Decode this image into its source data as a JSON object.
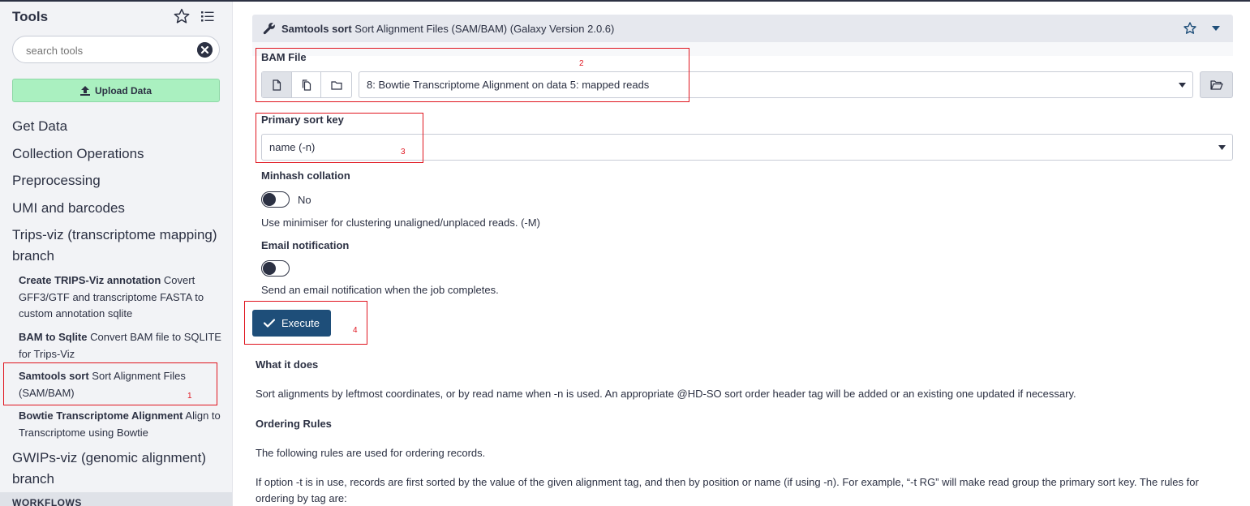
{
  "tools_panel": {
    "title": "Tools",
    "search": {
      "placeholder": "search tools",
      "value": ""
    },
    "upload_label": "Upload Data",
    "sections": [
      "Get Data",
      "Collection Operations",
      "Preprocessing",
      "UMI and barcodes",
      "Trips-viz (transcriptome mapping) branch",
      "GWIPs-viz (genomic alignment) branch"
    ],
    "tools": [
      {
        "name": "Create TRIPS-Viz annotation",
        "desc": " Covert GFF3/GTF and transcriptome FASTA to custom annotation sqlite"
      },
      {
        "name": "BAM to Sqlite",
        "desc": " Convert BAM file to SQLITE for Trips-Viz"
      },
      {
        "name": "Samtools sort",
        "desc": " Sort Alignment Files (SAM/BAM)"
      },
      {
        "name": "Bowtie Transcriptome Alignment",
        "desc": " Align to Transcriptome using Bowtie"
      }
    ],
    "workflows_label": "WORKFLOWS"
  },
  "tool_form": {
    "name": "Samtools sort",
    "description": " Sort Alignment Files (SAM/BAM) (Galaxy Version 2.0.6)",
    "bam_file": {
      "label": "BAM File",
      "value": "8: Bowtie Transcriptome Alignment on data 5: mapped reads"
    },
    "primary_sort_key": {
      "label": "Primary sort key",
      "value": "name (-n)"
    },
    "minhash": {
      "label": "Minhash collation",
      "toggle_text": "No",
      "help": "Use minimiser for clustering unaligned/unplaced reads. (-M)"
    },
    "email": {
      "label": "Email notification",
      "help": "Send an email notification when the job completes."
    },
    "execute_label": "Execute"
  },
  "help_section": {
    "what_it_does_title": "What it does",
    "what_it_does_text": "Sort alignments by leftmost coordinates, or by read name when -n is used. An appropriate @HD-SO sort order header tag will be added or an existing one updated if necessary.",
    "ordering_rules_title": "Ordering Rules",
    "ordering_rules_text": "The following rules are used for ordering records.",
    "option_t_text": "If option -t is in use, records are first sorted by the value of the given alignment tag, and then by position or name (if using -n). For example, “-t RG” will make read group the primary sort key. The rules for ordering by tag are:"
  },
  "annotations": [
    "1",
    "2",
    "3",
    "4"
  ],
  "colors": {
    "accent": "#1e4e79",
    "upload": "#aaf0c0",
    "annotation": "#e0141e"
  }
}
